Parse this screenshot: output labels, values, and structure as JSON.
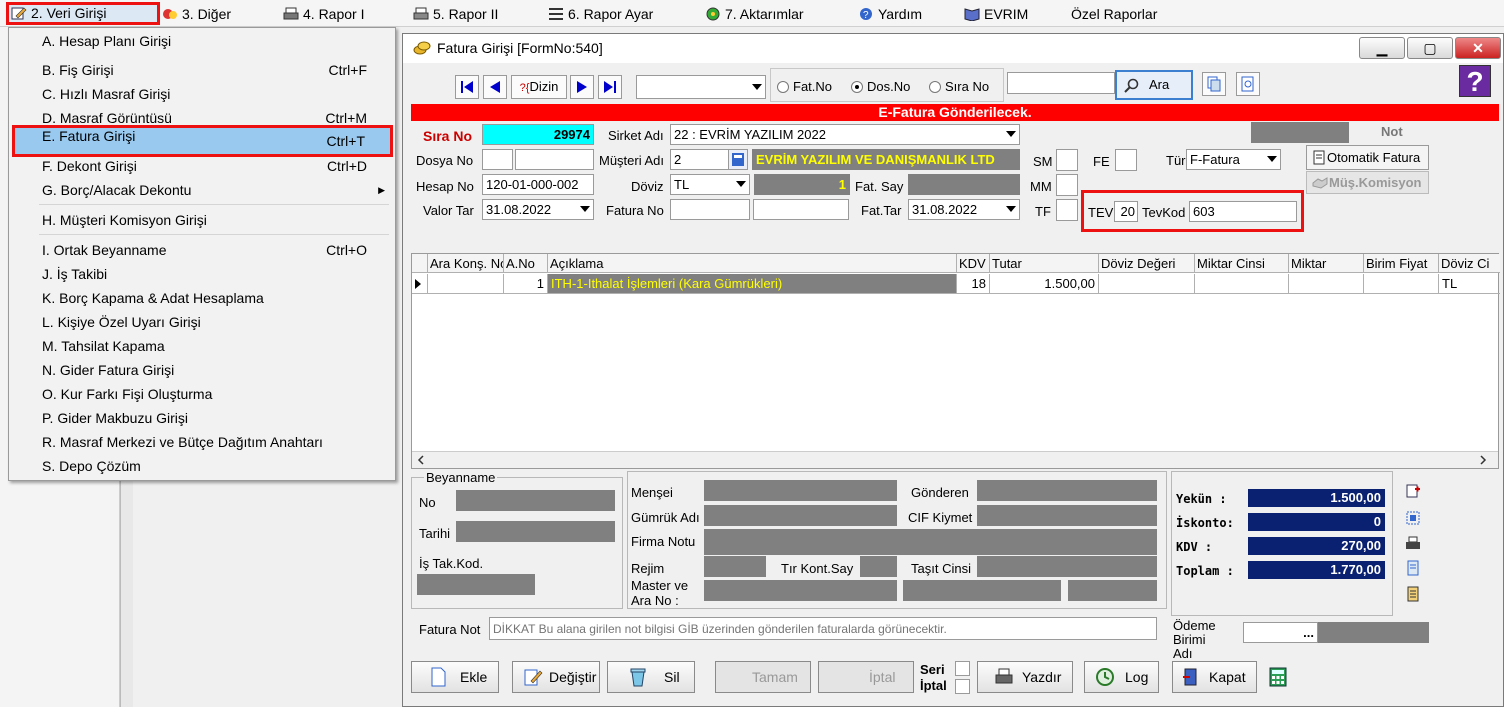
{
  "menubar": {
    "items": [
      {
        "label": "2.   Veri Girişi"
      },
      {
        "label": "3.   Diğer"
      },
      {
        "label": "4.   Rapor I"
      },
      {
        "label": "5.   Rapor II"
      },
      {
        "label": "6.   Rapor Ayar"
      },
      {
        "label": "7.   Aktarımlar"
      },
      {
        "label": "Yardım"
      },
      {
        "label": "EVRIM"
      },
      {
        "label": "Özel Raporlar"
      }
    ]
  },
  "dropdown": {
    "items": [
      {
        "label": "A.  Hesap Planı Girişi",
        "shortcut": ""
      },
      {
        "label": "B.  Fiş Girişi",
        "shortcut": "Ctrl+F"
      },
      {
        "label": "C.  Hızlı Masraf Girişi",
        "shortcut": ""
      },
      {
        "label": "D.  Masraf Görüntüsü",
        "shortcut": "Ctrl+M"
      },
      {
        "label": "E.   Fatura Girişi",
        "shortcut": "Ctrl+T"
      },
      {
        "label": "F.   Dekont Girişi",
        "shortcut": "Ctrl+D"
      },
      {
        "label": "G.  Borç/Alacak Dekontu",
        "shortcut": ""
      },
      {
        "label": "H.   Müşteri Komisyon Girişi",
        "shortcut": ""
      },
      {
        "label": "I.   Ortak Beyanname",
        "shortcut": "Ctrl+O"
      },
      {
        "label": "J.   İş Takibi",
        "shortcut": ""
      },
      {
        "label": "K.   Borç Kapama & Adat Hesaplama",
        "shortcut": ""
      },
      {
        "label": "L.   Kişiye Özel Uyarı Girişi",
        "shortcut": ""
      },
      {
        "label": "M.  Tahsilat Kapama",
        "shortcut": ""
      },
      {
        "label": "N. Gider Fatura Girişi",
        "shortcut": ""
      },
      {
        "label": "O. Kur Farkı Fişi Oluşturma",
        "shortcut": ""
      },
      {
        "label": "P. Gider Makbuzu Girişi",
        "shortcut": ""
      },
      {
        "label": "R. Masraf Merkezi ve Bütçe Dağıtım Anahtarı",
        "shortcut": ""
      },
      {
        "label": "S. Depo Çözüm",
        "shortcut": ""
      }
    ]
  },
  "window": {
    "title": "Fatura Girişi [FormNo:540]",
    "min": "▁",
    "max": "▢",
    "close": "✕"
  },
  "toolbar": {
    "nav_first": "⏮",
    "nav_prev": "◀",
    "dizin": "Dizin",
    "dizin_prefix": "?{",
    "nav_next": "▶",
    "nav_last": "⏭",
    "radio_fatno": "Fat.No",
    "radio_dosno": "Dos.No",
    "radio_sirano": "Sıra No",
    "search_value": "",
    "ara": "Ara",
    "help": "?"
  },
  "banner": "E-Fatura Gönderilecek.",
  "form": {
    "sira_no_label": "Sıra No",
    "sira_no": "29974",
    "sirket_label": "Sirket Adı",
    "sirket": "22 : EVRİM YAZILIM  2022",
    "not_label": "Not",
    "dosya_label": "Dosya No",
    "musteri_label": "Müşteri Adı",
    "musteri_code": "2",
    "musteri_name": "EVRİM YAZILIM VE DANIŞMANLIK LTD",
    "sm_label": "SM",
    "fe_label": "FE",
    "tur_label": "Tür",
    "tur": "F-Fatura",
    "oto_fatura": "Otomatik Fatura",
    "mus_komisyon": "Müş.Komisyon",
    "hesap_label": "Hesap No",
    "hesap": "120-01-000-002",
    "doviz_label": "Döviz",
    "doviz": "TL",
    "doviz_kur": "1",
    "fatsay_label": "Fat. Say",
    "mm_label": "MM",
    "valor_label": "Valor Tar",
    "valor": "31.08.2022",
    "fatno_label": "Fatura No",
    "fattar_label": "Fat.Tar",
    "fattar": "31.08.2022",
    "tf_label": "TF",
    "tev_label": "TEV",
    "tev": "20",
    "tevkod_label": "TevKod",
    "tevkod": "603"
  },
  "grid": {
    "headers": [
      "Ara Konş. No",
      "A.No",
      "Açıklama",
      "KDV",
      "Tutar",
      "Döviz Değeri",
      "Miktar Cinsi",
      "Miktar",
      "Birim Fiyat",
      "Döviz Ci"
    ],
    "rows": [
      {
        "ara": "",
        "ano": "1",
        "aciklama": "ITH-1-Ithalat İşlemleri  (Kara Gümrükleri)",
        "kdv": "18",
        "tutar": "1.500,00",
        "doviz": "",
        "mcins": "",
        "miktar": "",
        "bfiyat": "",
        "dcins": "TL"
      }
    ]
  },
  "beyanname": {
    "title": "Beyanname",
    "no": "No",
    "tarihi": "Tarihi",
    "istak": "İş Tak.Kod."
  },
  "mid": {
    "mensei": "Menşei",
    "gumruk": "Gümrük Adı",
    "firma": "Firma Notu",
    "rejim": "Rejim",
    "tirkont": "Tır Kont.Say",
    "master": "Master ve\nAra No :",
    "master1": "Master ve",
    "master2": "Ara No :",
    "gonderen": "Gönderen",
    "cif": "CIF Kiymet",
    "tasit": "Taşıt Cinsi"
  },
  "totals": {
    "yekun_label": "Yekün  :",
    "yekun": "1.500,00",
    "iskonto_label": "İskonto:",
    "iskonto": "0",
    "kdv_label": "KDV    :",
    "kdv": "270,00",
    "toplam_label": "Toplam :",
    "toplam": "1.770,00"
  },
  "fatura_not": {
    "label": "Fatura Not",
    "placeholder": "DİKKAT Bu alana girilen not bilgisi GİB üzerinden gönderilen faturalarda görünecektir."
  },
  "odeme": {
    "l1": "Ödeme",
    "l2": "Birimi",
    "l3": "Adı",
    "dots": "..."
  },
  "buttons": {
    "ekle": "Ekle",
    "degistir": "Değiştir",
    "sil": "Sil",
    "tamam": "Tamam",
    "iptal": "İptal",
    "seri": "Seri",
    "iptal2": "İptal",
    "yazdir": "Yazdır",
    "log": "Log",
    "kapat": "Kapat"
  },
  "colors": {
    "accent_red": "#ff0000",
    "cyan": "#00ffff",
    "navy": "#0a2070",
    "highlight": "#99c9ef"
  }
}
